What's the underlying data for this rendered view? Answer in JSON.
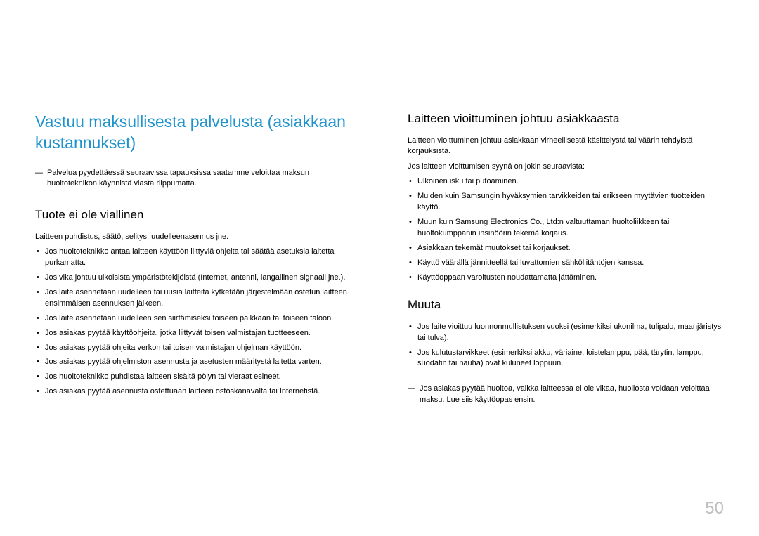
{
  "page_number": "50",
  "left": {
    "main_heading": "Vastuu maksullisesta palvelusta (asiakkaan kustannukset)",
    "dash_note": "Palvelua pyydettäessä seuraavissa tapauksissa saatamme veloittaa maksun huoltoteknikon käynnistä viasta riippumatta.",
    "section1": {
      "heading": "Tuote ei ole viallinen",
      "intro": "Laitteen puhdistus, säätö, selitys, uudelleenasennus jne.",
      "items": [
        "Jos huoltoteknikko antaa laitteen käyttöön liittyviä ohjeita tai säätää asetuksia laitetta purkamatta.",
        "Jos vika johtuu ulkoisista ympäristötekijöistä (Internet, antenni, langallinen signaali jne.).",
        "Jos laite asennetaan uudelleen tai uusia laitteita kytketään järjestelmään ostetun laitteen ensimmäisen asennuksen jälkeen.",
        "Jos laite asennetaan uudelleen sen siirtämiseksi toiseen paikkaan tai toiseen taloon.",
        "Jos asiakas pyytää käyttöohjeita, jotka liittyvät toisen valmistajan tuotteeseen.",
        "Jos asiakas pyytää ohjeita verkon tai toisen valmistajan ohjelman käyttöön.",
        "Jos asiakas pyytää ohjelmiston asennusta ja asetusten määritystä laitetta varten.",
        "Jos huoltoteknikko puhdistaa laitteen sisältä pölyn tai vieraat esineet.",
        "Jos asiakas pyytää asennusta ostettuaan laitteen ostoskanavalta tai Internetistä."
      ]
    }
  },
  "right": {
    "section2": {
      "heading": "Laitteen vioittuminen johtuu asiakkaasta",
      "intro1": "Laitteen vioittuminen johtuu asiakkaan virheellisestä käsittelystä tai väärin tehdyistä korjauksista.",
      "intro2": "Jos laitteen vioittumisen syynä on jokin seuraavista:",
      "items": [
        "Ulkoinen isku tai putoaminen.",
        "Muiden kuin Samsungin hyväksymien tarvikkeiden tai erikseen myytävien tuotteiden käyttö.",
        "Muun kuin Samsung Electronics Co., Ltd:n valtuuttaman huoltoliikkeen tai huoltokumppanin insinöörin tekemä korjaus.",
        "Asiakkaan tekemät muutokset tai korjaukset.",
        "Käyttö väärällä jännitteellä tai luvattomien sähköliitäntöjen kanssa.",
        "Käyttöoppaan varoitusten noudattamatta jättäminen."
      ]
    },
    "section3": {
      "heading": "Muuta",
      "items": [
        "Jos laite vioittuu luonnonmullistuksen vuoksi (esimerkiksi ukonilma, tulipalo, maanjäristys tai tulva).",
        "Jos kulutustarvikkeet (esimerkiksi akku, väriaine, loistelamppu, pää, tärytin, lamppu, suodatin tai nauha) ovat kuluneet loppuun."
      ],
      "dash_note": "Jos asiakas pyytää huoltoa, vaikka laitteessa ei ole vikaa, huollosta voidaan veloittaa maksu. Lue siis käyttöopas ensin."
    }
  }
}
